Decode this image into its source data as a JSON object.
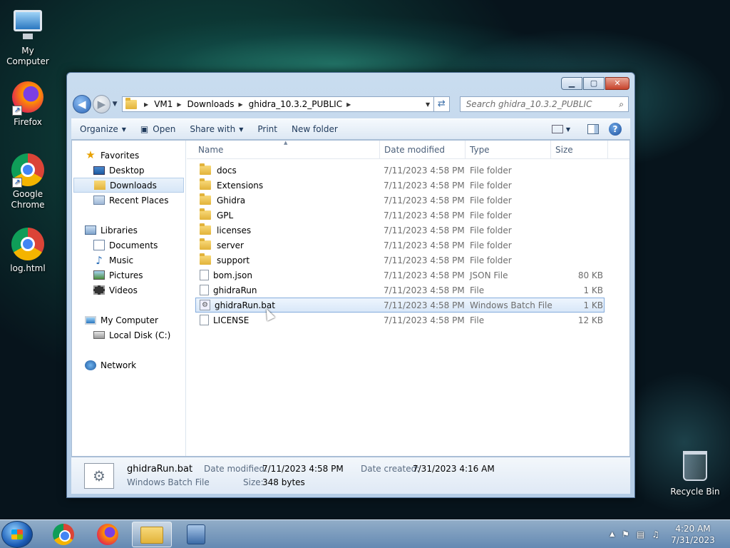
{
  "desktop": {
    "icons": [
      {
        "label": "My Computer"
      },
      {
        "label": "Firefox"
      },
      {
        "label": "Google Chrome"
      },
      {
        "label": "log.html"
      },
      {
        "label": "Recycle Bin"
      }
    ]
  },
  "window": {
    "controls": {
      "minimize": "▁",
      "maximize": "▢",
      "close": "✕"
    },
    "address": {
      "crumbs": [
        "VM1",
        "Downloads",
        "ghidra_10.3.2_PUBLIC"
      ],
      "back_icon": "◀"
    },
    "search": {
      "placeholder": "Search ghidra_10.3.2_PUBLIC"
    },
    "toolbar": {
      "organize": "Organize",
      "open": "Open",
      "share_with": "Share with",
      "print": "Print",
      "new_folder": "New folder",
      "help": "?"
    },
    "nav": {
      "favorites": "Favorites",
      "desktop": "Desktop",
      "downloads": "Downloads",
      "recent_places": "Recent Places",
      "libraries": "Libraries",
      "documents": "Documents",
      "music": "Music",
      "pictures": "Pictures",
      "videos": "Videos",
      "my_computer": "My Computer",
      "local_disk": "Local Disk (C:)",
      "network": "Network"
    },
    "columns": {
      "name": "Name",
      "date": "Date modified",
      "type": "Type",
      "size": "Size"
    },
    "files": [
      {
        "name": "docs",
        "date": "7/11/2023 4:58 PM",
        "type": "File folder",
        "size": ""
      },
      {
        "name": "Extensions",
        "date": "7/11/2023 4:58 PM",
        "type": "File folder",
        "size": ""
      },
      {
        "name": "Ghidra",
        "date": "7/11/2023 4:58 PM",
        "type": "File folder",
        "size": ""
      },
      {
        "name": "GPL",
        "date": "7/11/2023 4:58 PM",
        "type": "File folder",
        "size": ""
      },
      {
        "name": "licenses",
        "date": "7/11/2023 4:58 PM",
        "type": "File folder",
        "size": ""
      },
      {
        "name": "server",
        "date": "7/11/2023 4:58 PM",
        "type": "File folder",
        "size": ""
      },
      {
        "name": "support",
        "date": "7/11/2023 4:58 PM",
        "type": "File folder",
        "size": ""
      },
      {
        "name": "bom.json",
        "date": "7/11/2023 4:58 PM",
        "type": "JSON File",
        "size": "80 KB"
      },
      {
        "name": "ghidraRun",
        "date": "7/11/2023 4:58 PM",
        "type": "File",
        "size": "1 KB"
      },
      {
        "name": "ghidraRun.bat",
        "date": "7/11/2023 4:58 PM",
        "type": "Windows Batch File",
        "size": "1 KB"
      },
      {
        "name": "LICENSE",
        "date": "7/11/2023 4:58 PM",
        "type": "File",
        "size": "12 KB"
      }
    ],
    "details": {
      "name": "ghidraRun.bat",
      "type": "Windows Batch File",
      "date_modified_label": "Date modified:",
      "date_modified": "7/11/2023 4:58 PM",
      "date_created_label": "Date created:",
      "date_created": "7/31/2023 4:16 AM",
      "size_label": "Size:",
      "size": "348 bytes"
    }
  },
  "taskbar": {
    "time": "4:20 AM",
    "date": "7/31/2023",
    "tray_arrow": "▲"
  }
}
